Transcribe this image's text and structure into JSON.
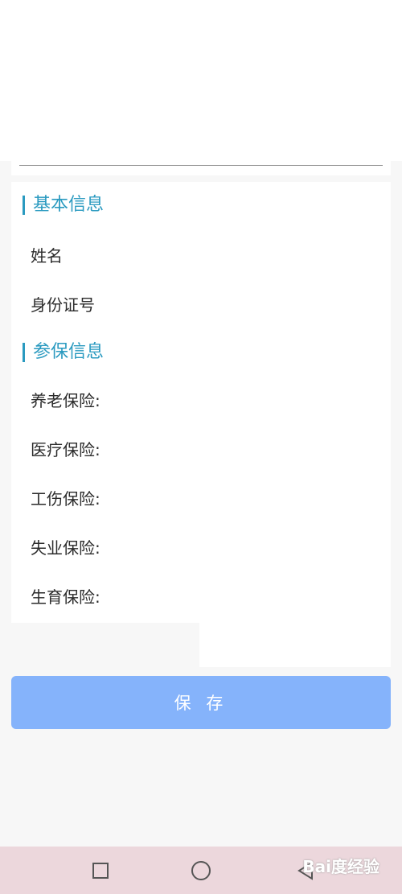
{
  "sections": {
    "basic": {
      "title": "基本信息",
      "fields": [
        "姓名",
        "身份证号"
      ]
    },
    "insurance": {
      "title": "参保信息",
      "fields": [
        "养老保险:",
        "医疗保险:",
        "工伤保险:",
        "失业保险:",
        "生育保险:"
      ]
    }
  },
  "save_button": {
    "label": "保 存"
  },
  "navbar": {
    "icons": [
      "square-recents-icon",
      "circle-home-icon",
      "triangle-back-icon"
    ]
  },
  "watermark": {
    "text": "Bai度经验"
  },
  "colors": {
    "accent": "#2a9ac0",
    "button": "#85b3fb",
    "navbar": "#ecd7dc",
    "background": "#f7f7f7"
  }
}
